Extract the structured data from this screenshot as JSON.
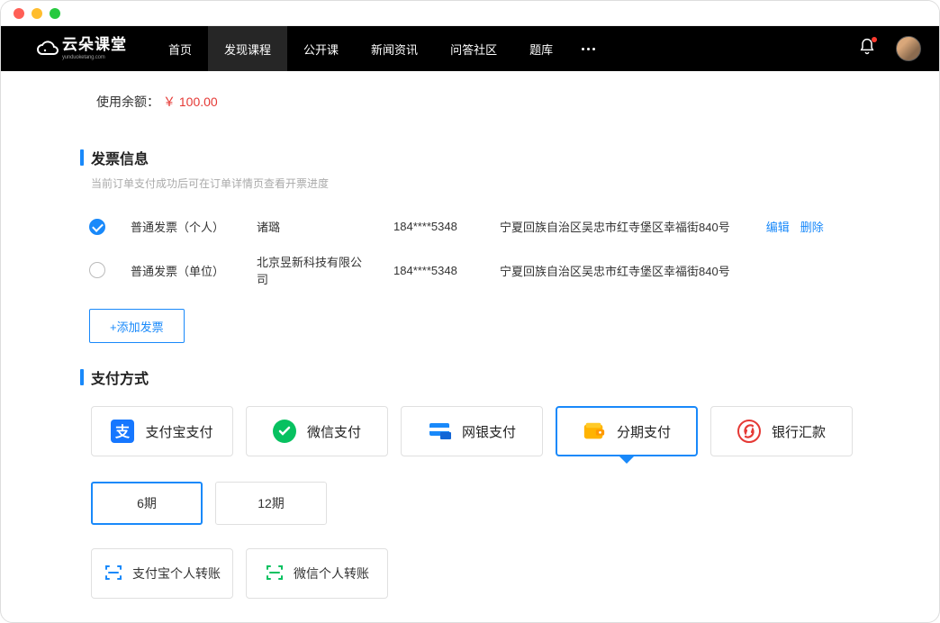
{
  "nav": {
    "items": [
      "首页",
      "发现课程",
      "公开课",
      "新闻资讯",
      "问答社区",
      "题库"
    ],
    "active": 1
  },
  "balance": {
    "label": "使用余额：",
    "amount": "￥ 100.00"
  },
  "invoice_section": {
    "title": "发票信息",
    "subtitle": "当前订单支付成功后可在订单详情页查看开票进度",
    "rows": [
      {
        "checked": true,
        "type": "普通发票（个人）",
        "name": "诸璐",
        "phone": "184****5348",
        "address": "宁夏回族自治区吴忠市红寺堡区幸福街840号",
        "edit": "编辑",
        "delete": "删除"
      },
      {
        "checked": false,
        "type": "普通发票（单位）",
        "name": "北京昱新科技有限公司",
        "phone": "184****5348",
        "address": "宁夏回族自治区吴忠市红寺堡区幸福街840号"
      }
    ],
    "add_button": "+添加发票"
  },
  "payment_section": {
    "title": "支付方式",
    "methods": [
      {
        "label": "支付宝支付",
        "icon": "alipay"
      },
      {
        "label": "微信支付",
        "icon": "wechat"
      },
      {
        "label": "网银支付",
        "icon": "bank"
      },
      {
        "label": "分期支付",
        "icon": "wallet",
        "selected": true
      },
      {
        "label": "银行汇款",
        "icon": "remit"
      }
    ],
    "installments": [
      {
        "label": "6期",
        "selected": true
      },
      {
        "label": "12期",
        "selected": false
      }
    ],
    "transfers": [
      {
        "label": "支付宝个人转账",
        "color": "#1989fa"
      },
      {
        "label": "微信个人转账",
        "color": "#07c160"
      }
    ]
  }
}
